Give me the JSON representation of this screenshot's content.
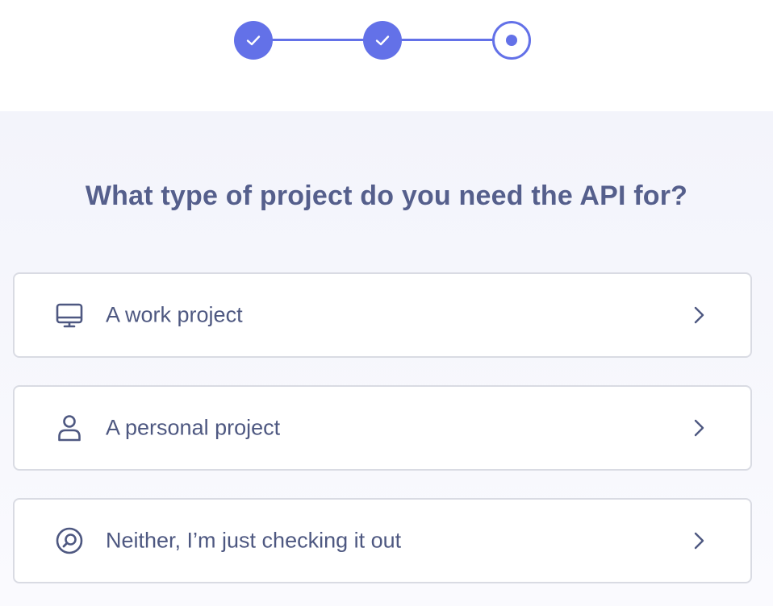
{
  "stepper": {
    "steps": [
      {
        "state": "completed",
        "icon": "check-icon"
      },
      {
        "state": "completed",
        "icon": "check-icon"
      },
      {
        "state": "current",
        "icon": "dot-icon"
      }
    ],
    "accent_color": "#6371e8"
  },
  "question": {
    "title": "What type of project do you need the API for?"
  },
  "options": [
    {
      "label": "A work project",
      "icon": "monitor-icon",
      "trailing_icon": "chevron-right-icon"
    },
    {
      "label": "A personal project",
      "icon": "user-icon",
      "trailing_icon": "chevron-right-icon"
    },
    {
      "label": "Neither, I’m just checking it out",
      "icon": "magnifier-icon",
      "trailing_icon": "chevron-right-icon"
    }
  ],
  "colors": {
    "title_text": "#555f8c",
    "option_text": "#4e5881",
    "card_border": "#d9dbe3",
    "background": "#f3f4fb"
  }
}
